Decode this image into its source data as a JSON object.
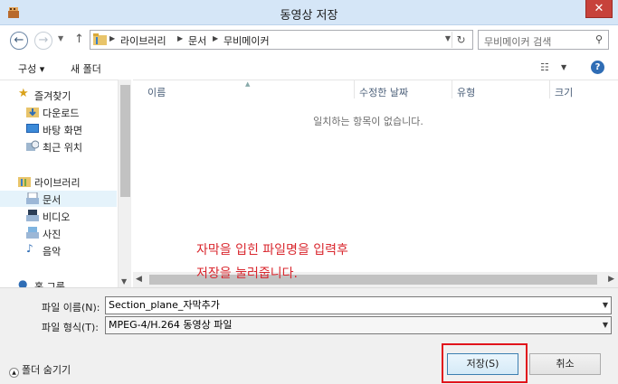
{
  "window": {
    "title": "동영상 저장",
    "close": "✕"
  },
  "address": {
    "back": "←",
    "forward": "→",
    "up": "↑",
    "crumbs": [
      "라이브러리",
      "문서",
      "무비메이커"
    ],
    "search_placeholder": "무비메이커 검색"
  },
  "toolbar": {
    "organize": "구성 ▾",
    "new_folder": "새 폴더",
    "help": "?"
  },
  "sidebar": {
    "favorites": "즐겨찾기",
    "favorites_items": [
      "다운로드",
      "바탕 화면",
      "최근 위치"
    ],
    "libraries": "라이브러리",
    "library_items": [
      "문서",
      "비디오",
      "사진",
      "음악"
    ],
    "homegroup": "홈 그룹"
  },
  "filelist": {
    "columns": [
      "이름",
      "수정한 날짜",
      "유형",
      "크기"
    ],
    "empty_message": "일치하는 항목이 없습니다."
  },
  "annotation": {
    "line1": "자막을 입힌 파일명을 입력후",
    "line2": "저장을 눌러줍니다."
  },
  "form": {
    "filename_label": "파일 이름(N):",
    "filename_value": "Section_plane_자막추가",
    "filetype_label": "파일 형식(T):",
    "filetype_value": "MPEG-4/H.264 동영상 파일"
  },
  "footer": {
    "hide_folders": "폴더 숨기기",
    "save": "저장(S)",
    "cancel": "취소"
  },
  "colors": {
    "titlebar": "#d5e6f7",
    "close": "#c7423b",
    "annotation": "#d9272e",
    "highlight": "#e1141c"
  }
}
